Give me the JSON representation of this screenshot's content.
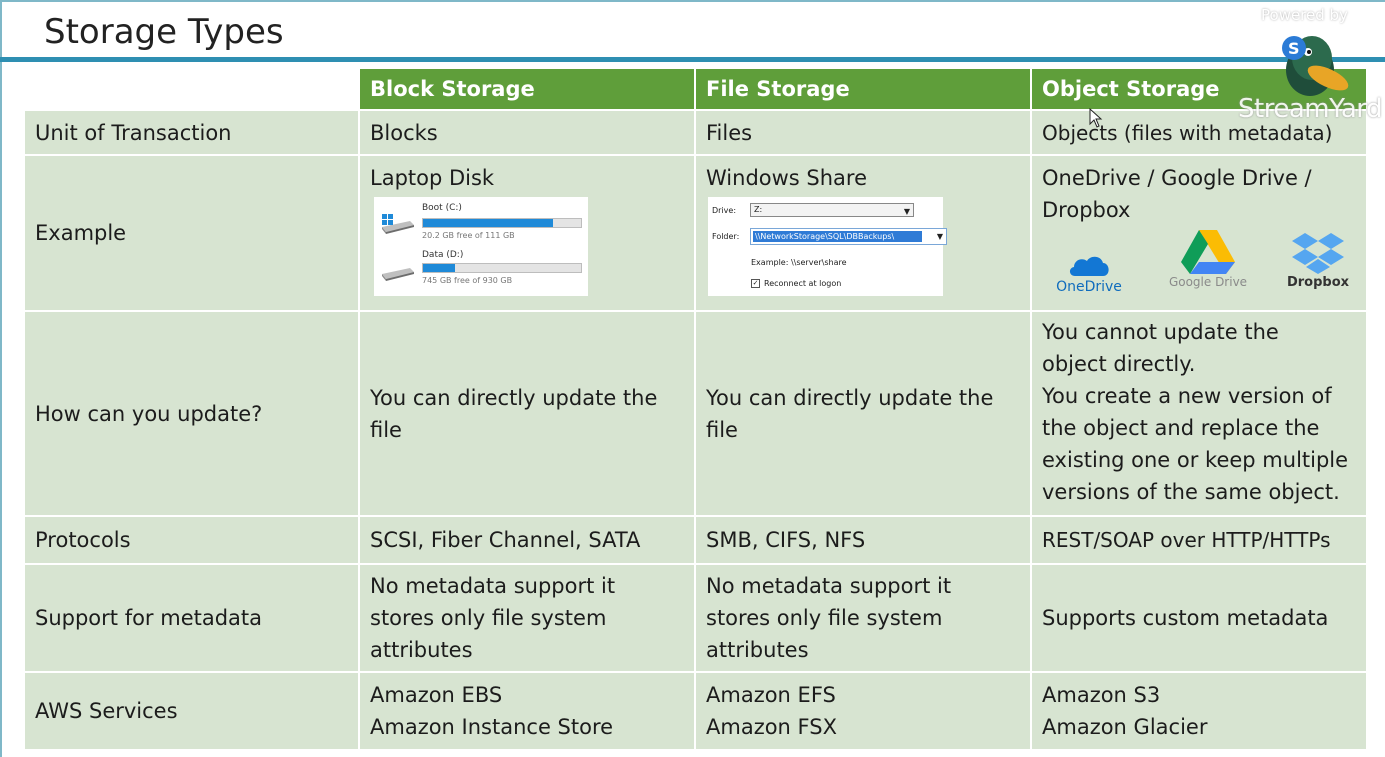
{
  "title": "Storage Types",
  "overlay": {
    "powered_by": "Powered by",
    "brand": "StreamYard"
  },
  "table": {
    "headers": [
      "Block Storage",
      "File Storage",
      "Object Storage"
    ],
    "rows": {
      "unit": {
        "label": "Unit of Transaction",
        "block": "Blocks",
        "file": "Files",
        "object": "Objects (files with metadata)"
      },
      "example": {
        "label": "Example",
        "block": "Laptop Disk",
        "file": "Windows Share",
        "object": "OneDrive / Google Drive / Dropbox"
      },
      "update": {
        "label": "How can you update?",
        "block": "You can directly update the file",
        "file": "You can directly update the file",
        "object": [
          "You cannot update the object directly.",
          "You create a new version of the object and replace the existing one or keep multiple versions of the same object."
        ]
      },
      "protocols": {
        "label": "Protocols",
        "block": "SCSI, Fiber Channel, SATA",
        "file": "SMB, CIFS, NFS",
        "object": "REST/SOAP over HTTP/HTTPs"
      },
      "metadata": {
        "label": "Support for metadata",
        "block": "No metadata support it stores only file system attributes",
        "file": "No metadata support it stores only file system attributes",
        "object": "Supports custom metadata"
      },
      "aws": {
        "label": "AWS Services",
        "block": [
          "Amazon EBS",
          "Amazon Instance Store"
        ],
        "file": [
          "Amazon EFS",
          "Amazon FSX"
        ],
        "object": [
          "Amazon S3",
          "Amazon Glacier"
        ]
      }
    }
  },
  "disk_example": {
    "drives": [
      {
        "name": "Boot (C:)",
        "free": "20.2 GB free of 111 GB",
        "used_fraction": 0.82
      },
      {
        "name": "Data (D:)",
        "free": "745 GB free of 930 GB",
        "used_fraction": 0.2
      }
    ]
  },
  "share_example": {
    "drive_label": "Drive:",
    "drive_value": "Z:",
    "folder_label": "Folder:",
    "folder_value": "\\\\NetworkStorage\\SQL\\DBBackups\\",
    "example_text": "Example: \\\\server\\share",
    "reconnect_label": "Reconnect at logon",
    "reconnect_checked": true
  },
  "cloud_logos": [
    "OneDrive",
    "Google Drive",
    "Dropbox"
  ],
  "colors": {
    "header_green": "#5f9e3a",
    "cell_green": "#d7e4d1",
    "title_rule": "#2e8fb2",
    "onedrive_blue": "#0f6cbd"
  }
}
